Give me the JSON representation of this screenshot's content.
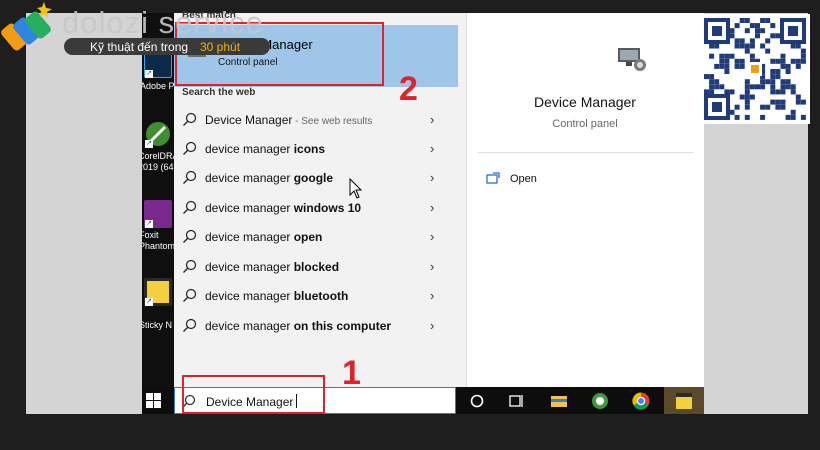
{
  "watermark": {
    "brand": "dolozi service",
    "tagline_main": "Kỹ thuật đến trong",
    "tagline_accent": "30 phút",
    "qr_icon": "qr-code-icon"
  },
  "desktop_icons": [
    {
      "label": "Adobe Photosh",
      "icon": "photoshop-icon"
    },
    {
      "label": "CorelDRA 2019 (64",
      "icon": "coreldraw-icon"
    },
    {
      "label": "Foxit PhantomP",
      "icon": "foxit-icon"
    },
    {
      "label": "Sticky N",
      "icon": "sticky-notes-icon"
    }
  ],
  "search": {
    "best_match_header": "Best match",
    "best_match_title": "Device Manager",
    "best_match_subtitle": "Control panel",
    "web_header": "Search the web",
    "web_results": [
      {
        "prefix": "Device Manager",
        "bold": "",
        "hint": " - See web results"
      },
      {
        "prefix": "device manager ",
        "bold": "icons",
        "hint": ""
      },
      {
        "prefix": "device manager ",
        "bold": "google",
        "hint": ""
      },
      {
        "prefix": "device manager ",
        "bold": "windows 10",
        "hint": ""
      },
      {
        "prefix": "device manager ",
        "bold": "open",
        "hint": ""
      },
      {
        "prefix": "device manager ",
        "bold": "blocked",
        "hint": ""
      },
      {
        "prefix": "device manager ",
        "bold": "bluetooth",
        "hint": ""
      },
      {
        "prefix": "device manager ",
        "bold": "on this computer",
        "hint": ""
      }
    ],
    "query": "Device Manager"
  },
  "detail": {
    "title": "Device Manager",
    "subtitle": "Control panel",
    "open_label": "Open"
  },
  "annotations": {
    "step1": "1",
    "step2": "2",
    "color": "#e0222a"
  },
  "taskbar": {
    "icons": [
      "windows-start-icon",
      "search-icon",
      "cortana-circle-icon",
      "task-view-icon",
      "file-explorer-icon",
      "refresh-app-icon",
      "chrome-icon",
      "sticky-notes-icon"
    ]
  },
  "colors": {
    "highlight": "#9fc6e8",
    "panel": "#f2f2f2",
    "taskbar": "#0d0d0d"
  }
}
